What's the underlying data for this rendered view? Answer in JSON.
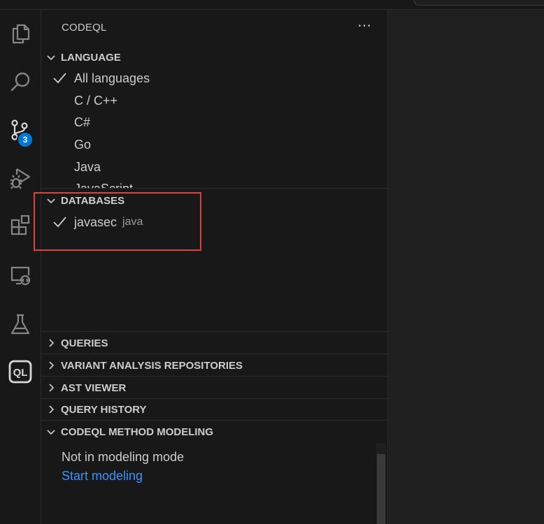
{
  "sidebar": {
    "title": "CODEQL",
    "more_label": "⋯"
  },
  "activity_bar": {
    "items": [
      "explorer",
      "search",
      "source-control",
      "run-and-debug",
      "extensions",
      "remote-explorer",
      "testing",
      "codeql"
    ],
    "source_control_badge": "3",
    "codeql_label": "QL"
  },
  "sections": {
    "language": {
      "label": "LANGUAGE",
      "items": [
        "All languages",
        "C / C++",
        "C#",
        "Go",
        "Java",
        "JavaScript"
      ],
      "checked": "All languages"
    },
    "databases": {
      "label": "DATABASES",
      "items": [
        {
          "name": "javasec",
          "language": "java",
          "checked": true
        }
      ]
    },
    "queries": {
      "label": "QUERIES"
    },
    "variant_analysis": {
      "label": "VARIANT ANALYSIS REPOSITORIES"
    },
    "ast_viewer": {
      "label": "AST VIEWER"
    },
    "query_history": {
      "label": "QUERY HISTORY"
    },
    "method_modeling": {
      "label": "CODEQL METHOD MODELING",
      "status_text": "Not in modeling mode",
      "action_link": "Start modeling"
    }
  },
  "colors": {
    "background": "#181818",
    "text": "#cccccc",
    "link": "#3794ff",
    "badge": "#0078d4",
    "highlight_box": "#e0403d"
  }
}
